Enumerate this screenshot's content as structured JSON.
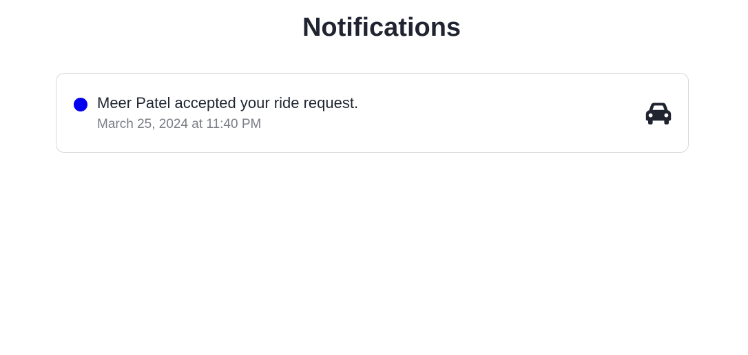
{
  "page": {
    "title": "Notifications"
  },
  "notifications": [
    {
      "message": "Meer Patel accepted your ride request.",
      "timestamp": "March 25, 2024 at 11:40 PM",
      "unread": true,
      "icon": "car-icon"
    }
  ],
  "colors": {
    "unread_dot": "#0000ee",
    "icon": "#1f2430",
    "border": "#d6d8dc",
    "timestamp": "#7a7d84"
  }
}
